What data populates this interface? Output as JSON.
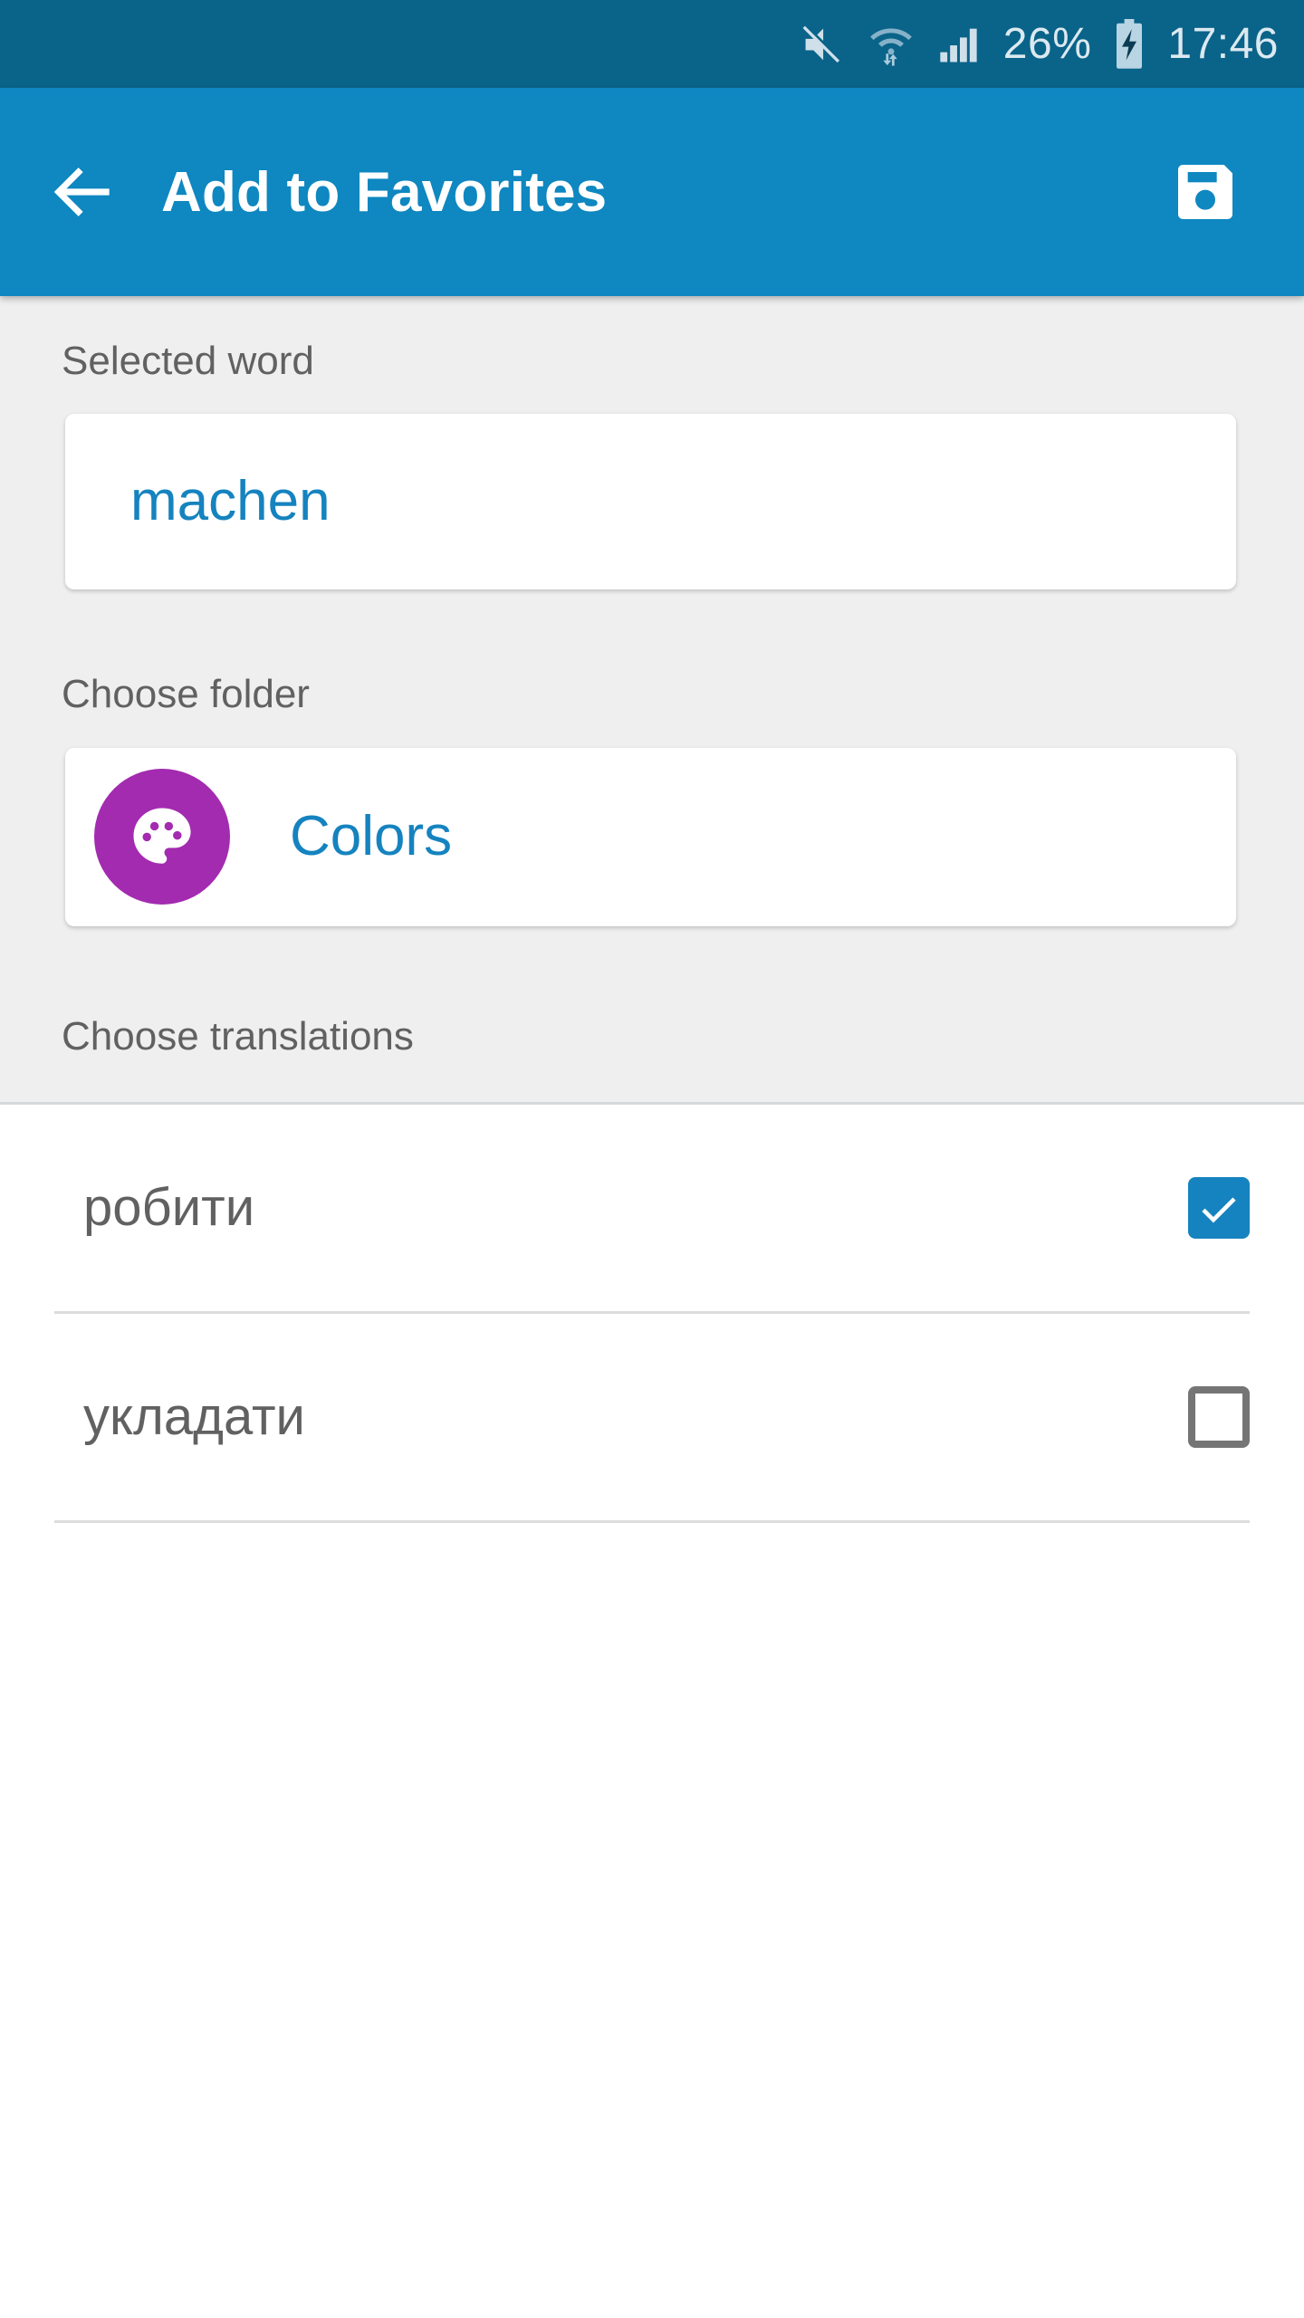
{
  "status_bar": {
    "background_color": "#0a6389",
    "battery_percent": "26%",
    "time": "17:46",
    "icons": [
      "mute-icon",
      "wifi-icon",
      "signal-icon",
      "battery-charging-icon"
    ]
  },
  "app_bar": {
    "background_color": "#0f87c0",
    "title": "Add to Favorites",
    "back_icon": "arrow-left-icon",
    "save_icon": "save-floppy-icon"
  },
  "form": {
    "selected_word": {
      "label": "Selected word",
      "value": "machen",
      "value_color": "#1583bf"
    },
    "choose_folder": {
      "label": "Choose folder",
      "folder_name": "Colors",
      "folder_icon": "palette-icon",
      "folder_icon_color": "#a32bb0",
      "value_color": "#1583bf"
    },
    "choose_translations": {
      "label": "Choose translations",
      "items": [
        {
          "label": "робити",
          "checked": true
        },
        {
          "label": "укладати",
          "checked": false
        }
      ]
    }
  },
  "colors": {
    "accent": "#1583bf",
    "background_grey": "#efefef",
    "text_grey": "#616161"
  }
}
